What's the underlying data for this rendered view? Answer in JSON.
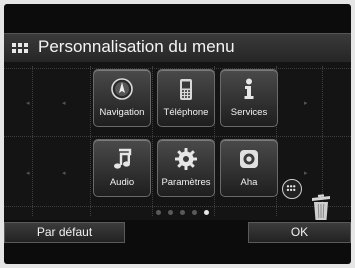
{
  "header": {
    "title": "Personnalisation du menu",
    "grid_icon": "menu-grid-icon"
  },
  "tiles": [
    {
      "label": "Navigation",
      "icon": "compass-icon"
    },
    {
      "label": "Téléphone",
      "icon": "phone-icon"
    },
    {
      "label": "Services",
      "icon": "info-icon"
    },
    {
      "label": "Audio",
      "icon": "music-note-icon"
    },
    {
      "label": "Paramètres",
      "icon": "gear-icon"
    },
    {
      "label": "Aha",
      "icon": "aha-icon"
    }
  ],
  "pager": {
    "count": 5,
    "active": 5
  },
  "footer": {
    "default_label": "Par défaut",
    "ok_label": "OK"
  },
  "colors": {
    "screen_bg": "#0c0c0c",
    "tile_text": "#f2f2f2"
  }
}
